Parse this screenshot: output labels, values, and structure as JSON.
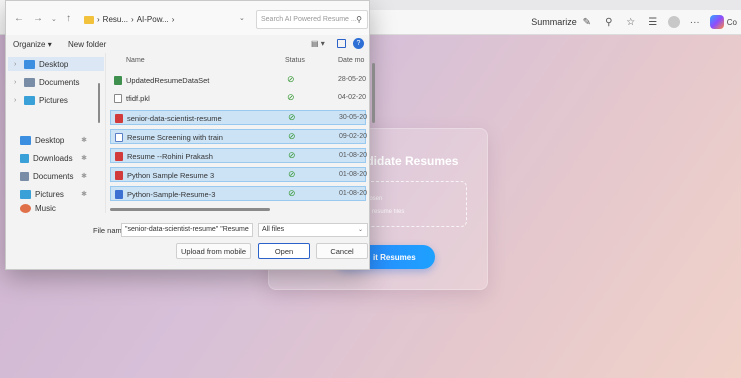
{
  "browser": {
    "summarize_label": "Summarize",
    "copilot_label": "Co"
  },
  "page": {
    "card_title": "ndidate Resumes",
    "drop_line1": "e chosen",
    "drop_line2": "ltiple resume files",
    "submit_label": "it Resumes"
  },
  "dialog": {
    "address": {
      "segments": [
        "Resu...",
        "AI-Pow...",
        ""
      ]
    },
    "search_placeholder": "Search AI Powered Resume ...",
    "organize_label": "Organize",
    "new_folder_label": "New folder",
    "nav": {
      "top_items": [
        {
          "label": "Desktop",
          "selected": true,
          "color": "#3b8ee0"
        },
        {
          "label": "Documents",
          "selected": false,
          "color": "#7a8da6"
        },
        {
          "label": "Pictures",
          "selected": false,
          "color": "#3aa0d8"
        }
      ],
      "quick_items": [
        {
          "label": "Desktop",
          "color": "#3b8ee0"
        },
        {
          "label": "Downloads",
          "color": "#3aa0d8"
        },
        {
          "label": "Documents",
          "color": "#7a8da6"
        },
        {
          "label": "Pictures",
          "color": "#3aa0d8"
        },
        {
          "label": "Music",
          "color": "#e0704a"
        }
      ]
    },
    "columns": {
      "name": "Name",
      "status": "Status",
      "date": "Date mo"
    },
    "files": [
      {
        "name": "UpdatedResumeDataSet",
        "date": "28-05-20",
        "selected": false,
        "icon_color": "#3f8f4f"
      },
      {
        "name": "tfidf.pkl",
        "date": "04-02-20",
        "selected": false,
        "icon_color": "#ffffff"
      },
      {
        "name": "senior-data-scientist-resume",
        "date": "30-05-20",
        "selected": true,
        "icon_color": "#d13b3b"
      },
      {
        "name": "Resume Screening with train",
        "date": "09-02-20",
        "selected": true,
        "icon_color": "#5b7fc7"
      },
      {
        "name": "Resume --Rohini Prakash",
        "date": "01-08-20",
        "selected": true,
        "icon_color": "#d13b3b"
      },
      {
        "name": "Python Sample Resume 3",
        "date": "01-08-20",
        "selected": true,
        "icon_color": "#d13b3b"
      },
      {
        "name": "Python-Sample-Resume-3",
        "date": "01-08-20",
        "selected": true,
        "icon_color": "#3b6fd1"
      }
    ],
    "file_name_label": "File name:",
    "file_name_value": "\"senior-data-scientist-resume\" \"Resume",
    "file_type": "All files",
    "upload_mobile_label": "Upload from mobile",
    "open_label": "Open",
    "cancel_label": "Cancel",
    "colors": {
      "accent": "#2b62c9",
      "selection": "#cce3f6",
      "check": "#3a9a3a"
    }
  }
}
